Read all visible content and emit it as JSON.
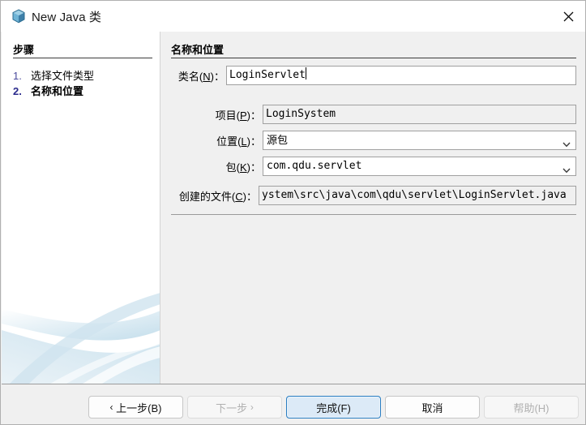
{
  "window": {
    "title": "New Java 类",
    "icon": "java-class-cube-icon",
    "close_label": "×"
  },
  "sidebar": {
    "heading": "步骤",
    "steps": [
      {
        "num": "1.",
        "label": "选择文件类型",
        "active": false
      },
      {
        "num": "2.",
        "label": "名称和位置",
        "active": true
      }
    ]
  },
  "main": {
    "heading": "名称和位置",
    "fields": {
      "class_name": {
        "label_text": "类名(",
        "label_mnemonic": "N",
        "label_tail": ")：",
        "value": "LoginServlet"
      },
      "project": {
        "label_text": "项目(",
        "label_mnemonic": "P",
        "label_tail": ")：",
        "value": "LoginSystem"
      },
      "location": {
        "label_text": "位置(",
        "label_mnemonic": "L",
        "label_tail": ")：",
        "value": "源包"
      },
      "package": {
        "label_text": "包(",
        "label_mnemonic": "K",
        "label_tail": ")：",
        "value": "com.qdu.servlet"
      },
      "created_file": {
        "label_text": "创建的文件(",
        "label_mnemonic": "C",
        "label_tail": ")：",
        "value": "ystem\\src\\java\\com\\qdu\\servlet\\LoginServlet.java"
      }
    }
  },
  "footer": {
    "buttons": {
      "back": "上一步(B)",
      "next": "下一步",
      "finish": "完成(F)",
      "cancel": "取消",
      "help": "帮助(H)"
    },
    "back_arrow": "‹",
    "next_arrow": "›"
  },
  "colors": {
    "accent": "#2a7ec2",
    "default_button_fill": "#dceaf7",
    "panel_background": "#f0f0f0",
    "sidebar_background": "#ffffff",
    "swoosh": "#c8dfea"
  }
}
